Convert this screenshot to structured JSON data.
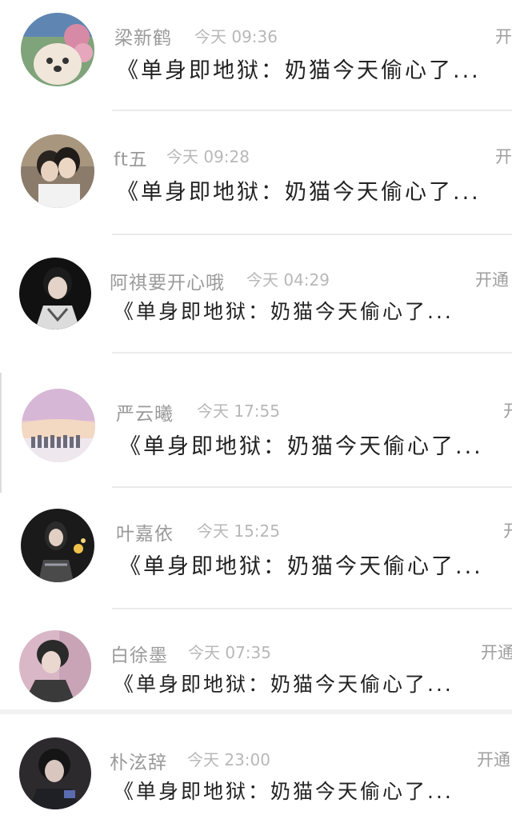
{
  "messages": [
    {
      "name": "梁新鹤",
      "time": "今天 09:36",
      "text": "《单身即地狱：奶猫今天偷心了...",
      "action": "开"
    },
    {
      "name": "ft五",
      "time": "今天 09:28",
      "text": "《单身即地狱：奶猫今天偷心了...",
      "action": "开"
    },
    {
      "name": "阿祺要开心哦",
      "time": "今天 04:29",
      "text": "《单身即地狱：奶猫今天偷心了...",
      "action": "开通"
    },
    {
      "name": "严云曦",
      "time": "今天 17:55",
      "text": "《单身即地狱：奶猫今天偷心了...",
      "action": "开"
    },
    {
      "name": "叶嘉依",
      "time": "今天 15:25",
      "text": "《单身即地狱：奶猫今天偷心了...",
      "action": "开"
    },
    {
      "name": "白徐墨",
      "time": "今天 07:35",
      "text": "《单身即地狱：奶猫今天偷心了...",
      "action": "开通"
    },
    {
      "name": "朴泫辞",
      "time": "今天 23:00",
      "text": "《单身即地狱：奶猫今天偷心了...",
      "action": "开通"
    }
  ]
}
